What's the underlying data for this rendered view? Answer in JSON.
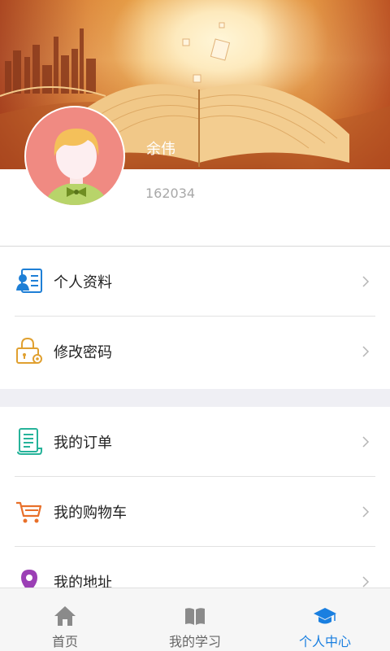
{
  "profile": {
    "name": "余伟",
    "user_id": "162034"
  },
  "menu_group_1": [
    {
      "label": "个人资料",
      "icon": "id-card-icon"
    },
    {
      "label": "修改密码",
      "icon": "lock-settings-icon"
    }
  ],
  "menu_group_2": [
    {
      "label": "我的订单",
      "icon": "order-scroll-icon"
    },
    {
      "label": "我的购物车",
      "icon": "shopping-cart-icon"
    },
    {
      "label": "我的地址",
      "icon": "location-pin-icon"
    }
  ],
  "tabbar": {
    "tabs": [
      {
        "label": "首页",
        "icon": "home-icon",
        "active": false
      },
      {
        "label": "我的学习",
        "icon": "book-icon",
        "active": false
      },
      {
        "label": "个人中心",
        "icon": "graduation-cap-icon",
        "active": true
      }
    ]
  },
  "colors": {
    "active_tab": "#1a7fe0",
    "inactive_tab": "#666666",
    "avatar_bg": "#f08a82"
  }
}
